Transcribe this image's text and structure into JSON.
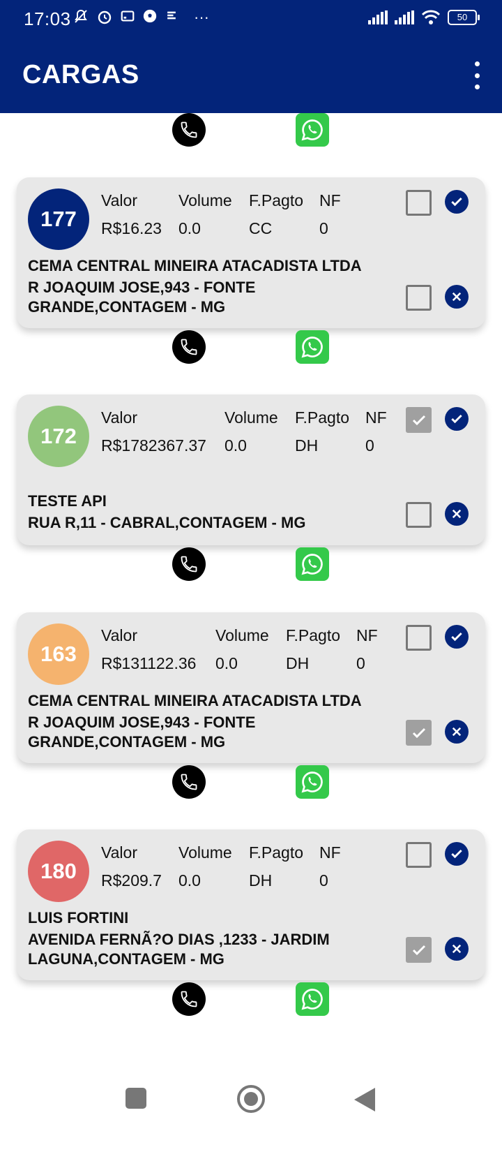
{
  "status_bar": {
    "time": "17:03",
    "dots": "···",
    "battery": "50",
    "icons": [
      "mute-icon",
      "alarm-icon",
      "screen-icon",
      "soccer-icon",
      "vpn-icon",
      "signal-icon",
      "signal-icon",
      "wifi-icon",
      "battery-icon"
    ]
  },
  "app_bar": {
    "title": "CARGAS",
    "menu_icon": "more-vert-icon"
  },
  "colors": {
    "primary": "#03247a",
    "card": "#e8e8e8",
    "whatsapp": "#34c94a"
  },
  "labels": {
    "valor": "Valor",
    "volume": "Volume",
    "fpagto": "F.Pagto",
    "nf": "NF"
  },
  "cards": [
    {
      "id": "177",
      "color": "#03247a",
      "valor": "R$16.23",
      "volume": "0.0",
      "fpagto": "CC",
      "nf": "0",
      "name": "CEMA CENTRAL MINEIRA ATACADISTA LTDA",
      "address": "R JOAQUIM JOSE,943 - FONTE GRANDE,CONTAGEM - MG",
      "checkbox_top_checked": false,
      "checkbox_bottom_checked": false
    },
    {
      "id": "172",
      "color": "#92c67c",
      "valor": "R$1782367.37",
      "volume": "0.0",
      "fpagto": "DH",
      "nf": "0",
      "name": "TESTE API",
      "address": "RUA R,11 - CABRAL,CONTAGEM - MG",
      "checkbox_top_checked": true,
      "checkbox_bottom_checked": false
    },
    {
      "id": "163",
      "color": "#f5b36e",
      "valor": "R$131122.36",
      "volume": "0.0",
      "fpagto": "DH",
      "nf": "0",
      "name": "CEMA CENTRAL MINEIRA ATACADISTA LTDA",
      "address": "R JOAQUIM JOSE,943 - FONTE GRANDE,CONTAGEM - MG",
      "checkbox_top_checked": false,
      "checkbox_bottom_checked": true
    },
    {
      "id": "180",
      "color": "#e06767",
      "valor": "R$209.7",
      "volume": "0.0",
      "fpagto": "DH",
      "nf": "0",
      "name": "LUIS FORTINI",
      "address": "AVENIDA FERNÃ?O DIAS ,1233 - JARDIM LAGUNA,CONTAGEM - MG",
      "checkbox_top_checked": false,
      "checkbox_bottom_checked": true
    }
  ],
  "contact_icons": {
    "phone": "phone-icon",
    "whatsapp": "whatsapp-icon"
  },
  "nav_bar": [
    "recents-button",
    "home-button",
    "back-button"
  ]
}
